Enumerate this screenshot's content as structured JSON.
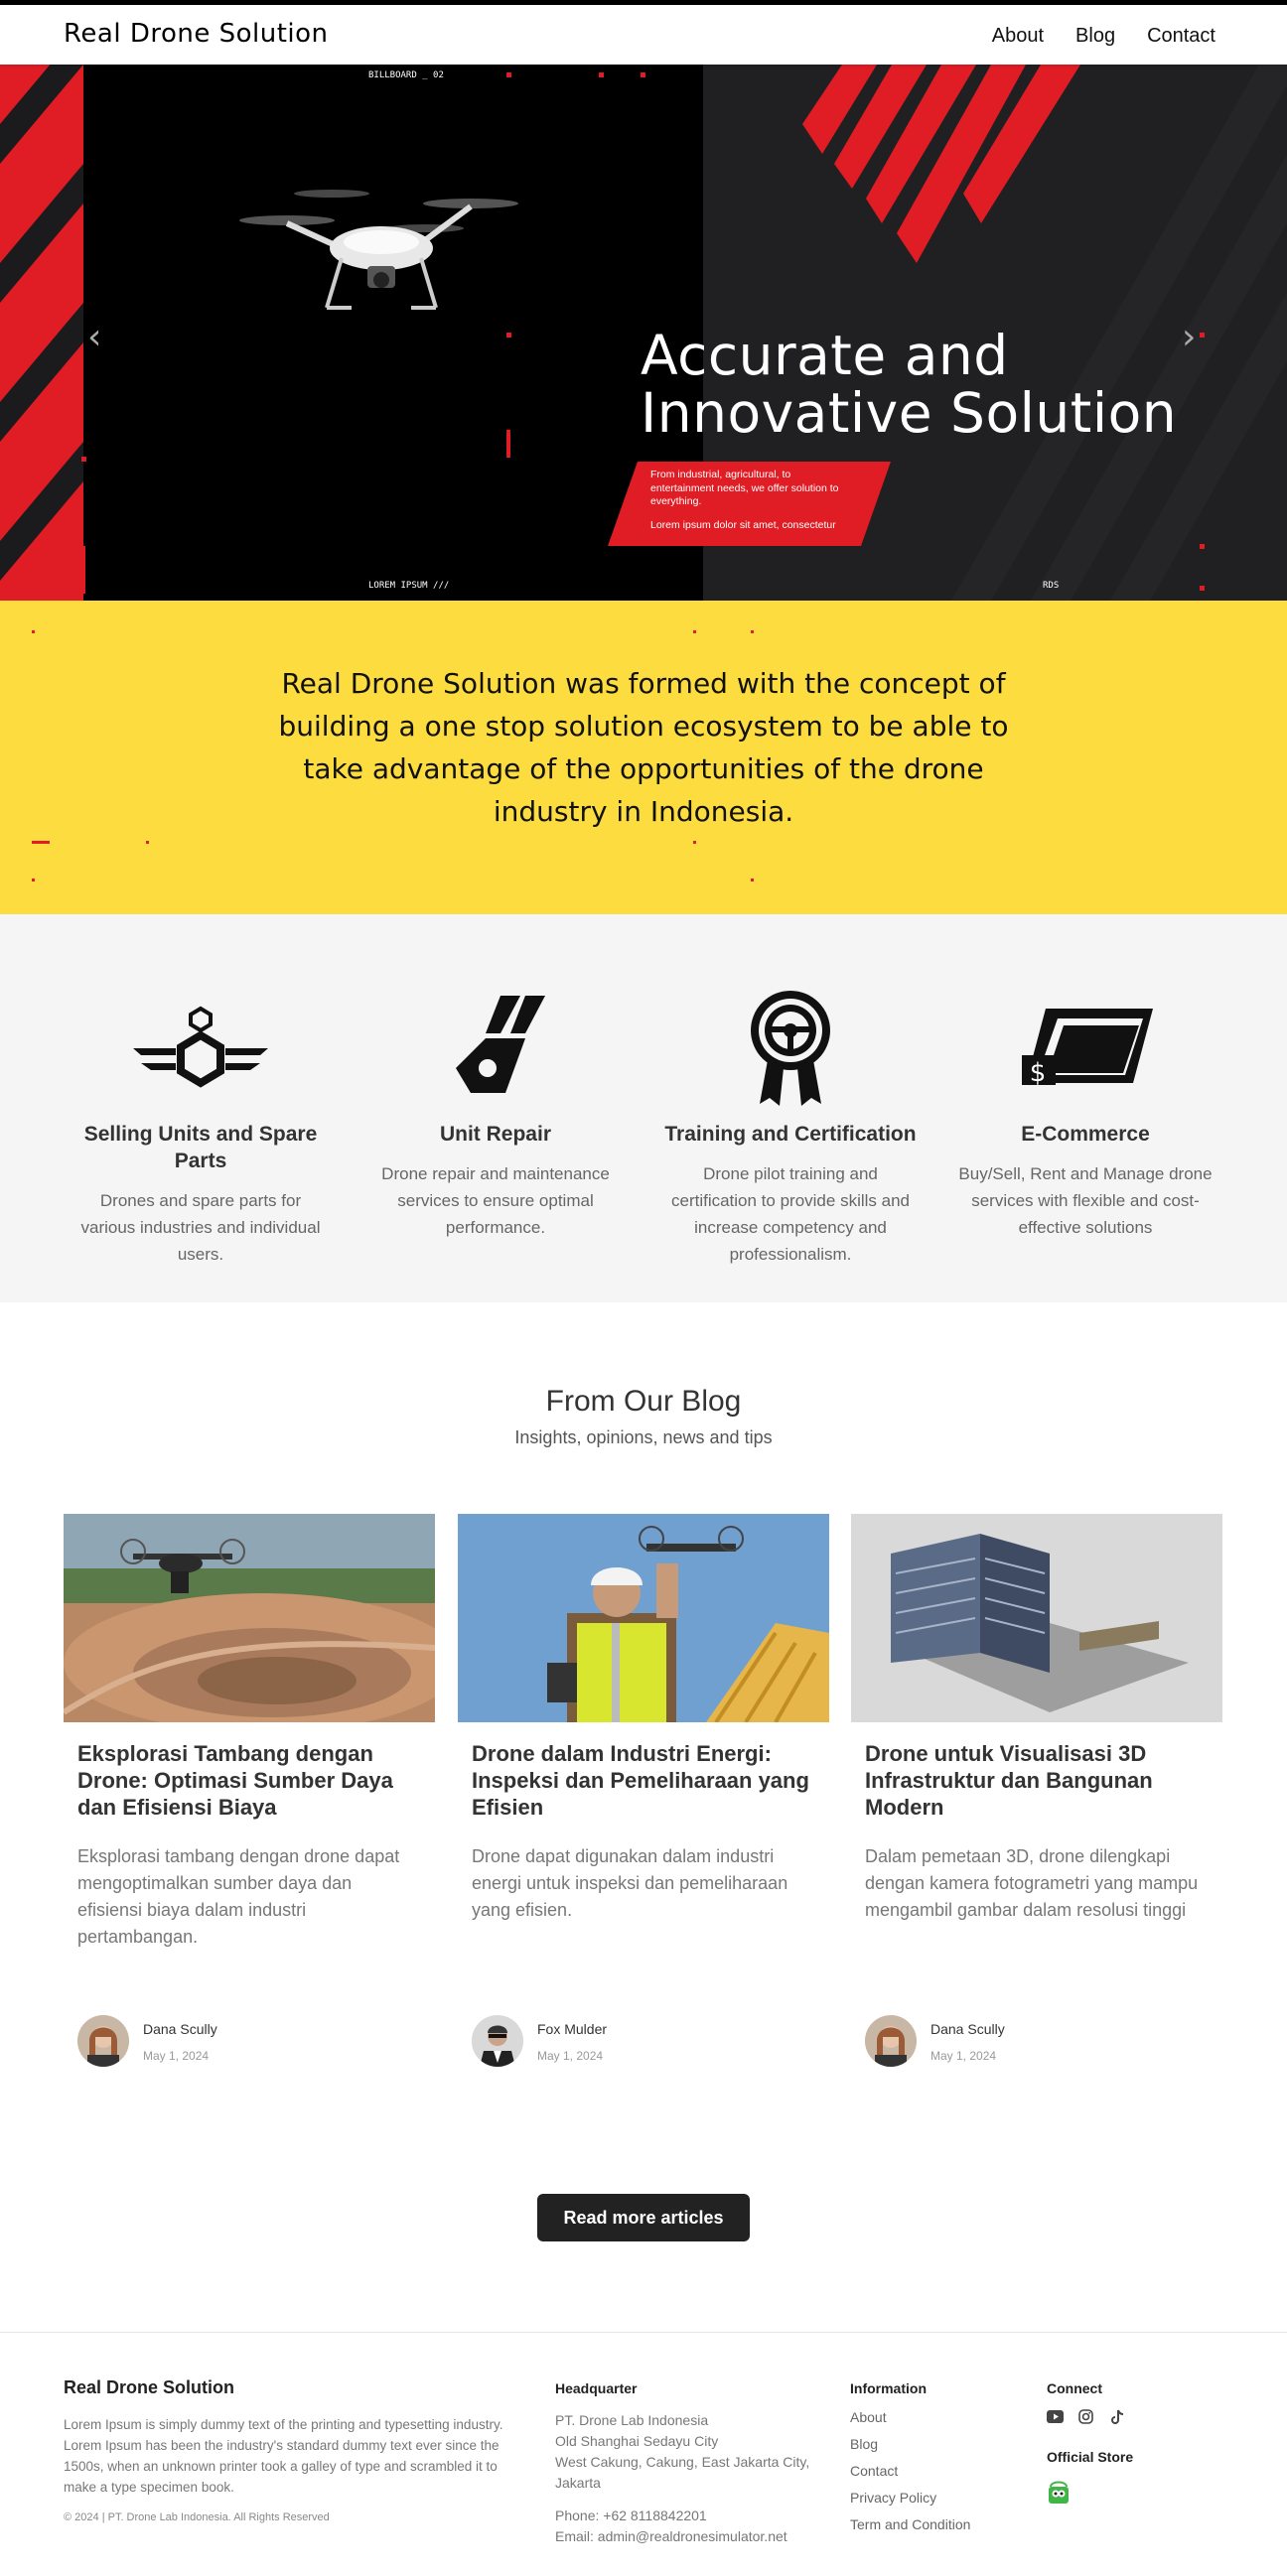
{
  "nav": {
    "brand": "Real Drone Solution",
    "links": [
      "About",
      "Blog",
      "Contact"
    ]
  },
  "hero": {
    "title_line1": "Accurate and",
    "title_line2": "Innovative Solution",
    "subtitle": "From industrial, agricultural, to entertainment needs, we offer solution to everything.",
    "subtitle2": "Lorem ipsum dolor sit amet, consectetur",
    "caption_top": "BILLBOARD _ 02",
    "caption_bottom": "LOREM IPSUM ///",
    "caption_right": "RDS",
    "colors": {
      "accent": "#e01c24",
      "dark": "#1b1b1d"
    }
  },
  "mission": {
    "text": "Real Drone Solution was formed with the concept of building a one stop solution ecosystem to be able to take advantage of the opportunities of the drone industry in Indonesia."
  },
  "services": [
    {
      "icon": "drone-wings-icon",
      "title": "Selling Units and Spare Parts",
      "desc": "Drones and spare parts for various industries and individual users."
    },
    {
      "icon": "wrench-icon",
      "title": "Unit Repair",
      "desc": "Drone repair and maintenance services to ensure optimal performance."
    },
    {
      "icon": "certificate-badge-icon",
      "title": "Training and Certification",
      "desc": "Drone pilot training and certification to provide skills and increase competency and professionalism."
    },
    {
      "icon": "dollar-card-icon",
      "title": "E-Commerce",
      "desc": "Buy/Sell, Rent and Manage drone services with flexible and cost-effective solutions"
    }
  ],
  "blog": {
    "title": "From Our Blog",
    "subtitle": "Insights, opinions, news and tips",
    "posts": [
      {
        "title": "Eksplorasi Tambang dengan Drone: Optimasi Sumber Daya dan Efisiensi Biaya",
        "excerpt": "Eksplorasi tambang dengan drone dapat mengoptimalkan sumber daya dan efisiensi biaya dalam industri pertambangan.",
        "author": "Dana Scully",
        "date": "May 1, 2024"
      },
      {
        "title": "Drone dalam Industri Energi: Inspeksi dan Pemeliharaan yang Efisien",
        "excerpt": "Drone dapat digunakan dalam industri energi untuk inspeksi dan pemeliharaan yang efisien.",
        "author": "Fox Mulder",
        "date": "May 1, 2024"
      },
      {
        "title": "Drone untuk Visualisasi 3D Infrastruktur dan Bangunan Modern",
        "excerpt": "Dalam pemetaan 3D, drone dilengkapi dengan kamera fotogrametri yang mampu mengambil gambar dalam resolusi tinggi",
        "author": "Dana Scully",
        "date": "May 1, 2024"
      }
    ],
    "read_more": "Read more articles"
  },
  "footer": {
    "brand": "Real Drone Solution",
    "desc": "Lorem Ipsum is simply dummy text of the printing and typesetting industry. Lorem Ipsum has been the industry's standard dummy text ever since the 1500s, when an unknown printer took a galley of type and scrambled it to make a type specimen book.",
    "copyright": "© 2024 | PT. Drone Lab Indonesia. All Rights Reserved",
    "hq": {
      "heading": "Headquarter",
      "company": "PT. Drone Lab Indonesia",
      "addr1": "Old Shanghai Sedayu City",
      "addr2": "West Cakung, Cakung, East Jakarta City,",
      "addr3": "Jakarta",
      "phone": "Phone: +62 8118842201",
      "email": "Email: admin@realdronesimulator.net"
    },
    "info": {
      "heading": "Information",
      "links": [
        "About",
        "Blog",
        "Contact",
        "Privacy Policy",
        "Term and Condition"
      ]
    },
    "connect": {
      "heading": "Connect",
      "socials": [
        "youtube-icon",
        "instagram-icon",
        "tiktok-icon"
      ],
      "store_heading": "Official Store",
      "store_icon": "tokopedia-icon"
    }
  }
}
